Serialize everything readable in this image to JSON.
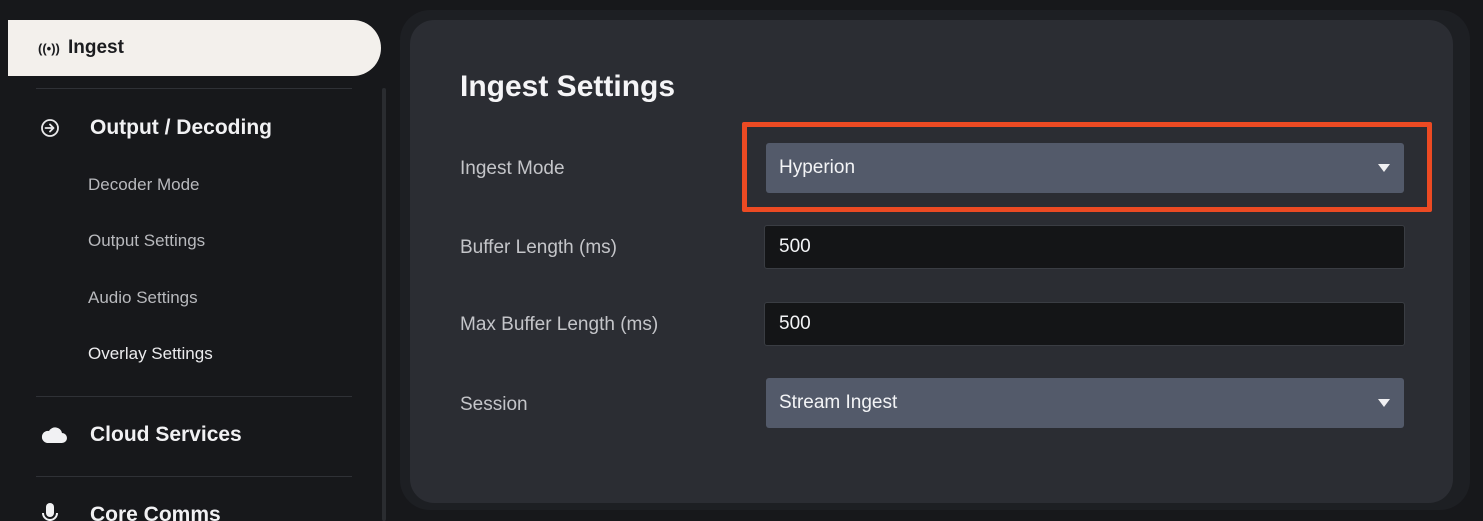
{
  "sidebar": {
    "active_item": {
      "label": "Ingest",
      "icon": "broadcast-icon"
    },
    "sections": [
      {
        "label": "Output / Decoding",
        "icon": "circle-arrow-right-icon",
        "items": [
          "Decoder Mode",
          "Output Settings",
          "Audio Settings",
          "Overlay Settings"
        ]
      },
      {
        "label": "Cloud Services",
        "icon": "cloud-icon"
      },
      {
        "label": "Core Comms",
        "icon": "microphone-icon"
      }
    ]
  },
  "panel": {
    "title": "Ingest Settings",
    "fields": {
      "ingest_mode": {
        "label": "Ingest Mode",
        "value": "Hyperion"
      },
      "buffer_length": {
        "label": "Buffer Length (ms)",
        "value": "500"
      },
      "max_buffer_length": {
        "label": "Max Buffer Length (ms)",
        "value": "500"
      },
      "session": {
        "label": "Session",
        "value": "Stream Ingest"
      }
    }
  },
  "colors": {
    "highlight": "#ec4a23",
    "active_nav_bg": "#f3f0ec",
    "select_bg": "#535a6a",
    "panel_bg": "#2b2d33"
  }
}
